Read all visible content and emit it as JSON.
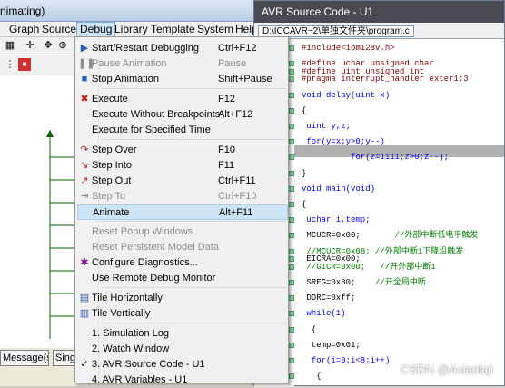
{
  "left_window": {
    "title": "nimating)",
    "menubar": [
      "Graph",
      "Source",
      "Debug",
      "Library",
      "Template",
      "System",
      "Help"
    ],
    "status_buttons": [
      "Message(s)",
      "Single"
    ]
  },
  "debug_menu": {
    "items": [
      {
        "label": "Start/Restart Debugging",
        "shortcut": "Ctrl+F12",
        "disabled": false,
        "icon": "start-debug-icon"
      },
      {
        "label": "Pause Animation",
        "shortcut": "Pause",
        "disabled": true,
        "icon": "pause-icon"
      },
      {
        "label": "Stop Animation",
        "shortcut": "Shift+Pause",
        "disabled": false,
        "icon": "stop-icon"
      },
      {
        "label": "Execute",
        "shortcut": "F12",
        "disabled": false,
        "icon": "execute-icon"
      },
      {
        "label": "Execute Without Breakpoints",
        "shortcut": "Alt+F12",
        "disabled": false,
        "icon": ""
      },
      {
        "label": "Execute for Specified Time",
        "shortcut": "",
        "disabled": false,
        "icon": ""
      },
      {
        "label": "Step Over",
        "shortcut": "F10",
        "disabled": false,
        "icon": "step-over-icon"
      },
      {
        "label": "Step Into",
        "shortcut": "F11",
        "disabled": false,
        "icon": "step-into-icon"
      },
      {
        "label": "Step Out",
        "shortcut": "Ctrl+F11",
        "disabled": false,
        "icon": "step-out-icon"
      },
      {
        "label": "Step To",
        "shortcut": "Ctrl+F10",
        "disabled": true,
        "icon": "step-to-icon"
      },
      {
        "label": "Animate",
        "shortcut": "Alt+F11",
        "disabled": false,
        "icon": ""
      },
      {
        "label": "Reset Popup Windows",
        "shortcut": "",
        "disabled": true,
        "icon": ""
      },
      {
        "label": "Reset Persistent Model Data",
        "shortcut": "",
        "disabled": true,
        "icon": ""
      },
      {
        "label": "Configure Diagnostics...",
        "shortcut": "",
        "disabled": false,
        "icon": "diagnostics-icon"
      },
      {
        "label": "Use Remote Debug Monitor",
        "shortcut": "",
        "disabled": false,
        "icon": ""
      },
      {
        "label": "Tile Horizontally",
        "shortcut": "",
        "disabled": false,
        "icon": "tile-horizontal-icon"
      },
      {
        "label": "Tile Vertically",
        "shortcut": "",
        "disabled": false,
        "icon": "tile-vertical-icon"
      },
      {
        "label": "1. Simulation Log",
        "shortcut": "",
        "disabled": false,
        "icon": ""
      },
      {
        "label": "2. Watch Window",
        "shortcut": "",
        "disabled": false,
        "icon": ""
      },
      {
        "label": "3. AVR Source Code - U1",
        "shortcut": "",
        "disabled": false,
        "icon": "check-icon"
      },
      {
        "label": "4. AVR Variables - U1",
        "shortcut": "",
        "disabled": false,
        "icon": ""
      }
    ],
    "highlighted": "Animate"
  },
  "source_window": {
    "title": "AVR Source Code - U1",
    "path": "D:\\ICCAVR~2\\单独文件夹\\program.c",
    "lines": [
      "#include<iom128v.h>",
      "",
      "#define uchar unsigned char",
      "#define uint unsigned int",
      "#pragma interrupt_handler exter1:3",
      "",
      "void delay(uint x)",
      "",
      "{",
      "",
      " uint y,z;",
      "",
      " for(y=x;y>0;y--)",
      "",
      "          for(z=1111;z>0;z--);",
      "",
      "}",
      "",
      "void main(void)",
      "",
      "{",
      "",
      " uchar i,temp;",
      "",
      " MCUCR=0x00;       //外部中断低电平触发",
      "",
      " //MCUCR=0x08; //外部中断1下降沿触发",
      " EICRA=0x00;",
      " //GICR=0x00;   //开外部中断1",
      "",
      " SREG=0x80;    //开全局中断",
      "",
      " DDRC=0xff;",
      "",
      " while(1)",
      "",
      "  {",
      "",
      "  temp=0x01;",
      "",
      "  for(i=0;i<8;i++)",
      "",
      "   {"
    ]
  },
  "watermark": "CSDN @Axiaolaji",
  "colors": {
    "keyword": "#0000ff",
    "comment": "#008000",
    "number": "#ff0000",
    "highlight": "#cde4f7"
  }
}
